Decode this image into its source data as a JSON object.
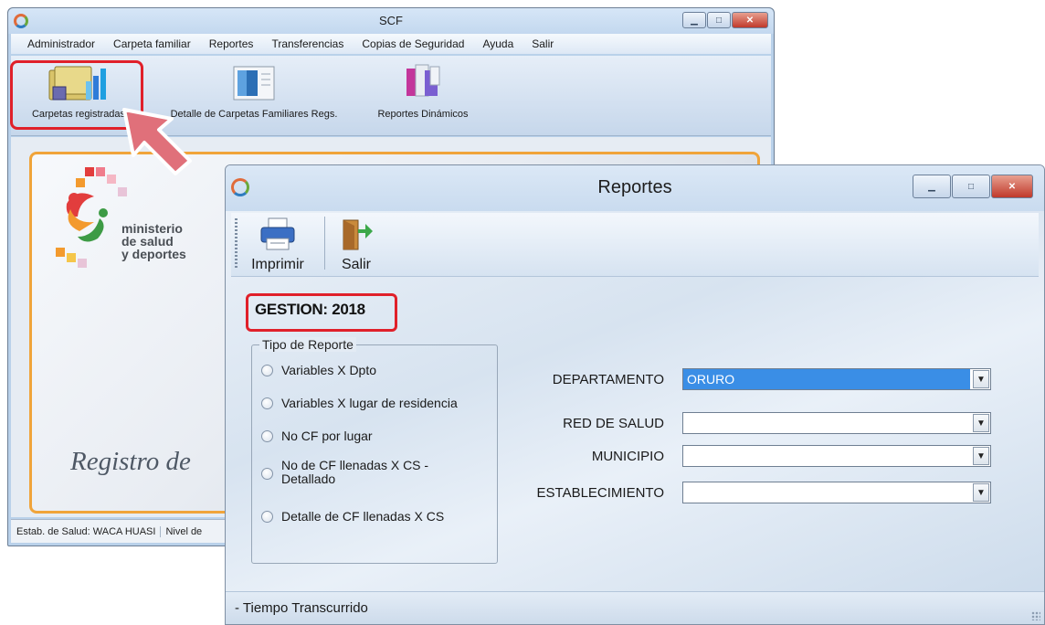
{
  "scf": {
    "title": "SCF",
    "menu": [
      "Administrador",
      "Carpeta familiar",
      "Reportes",
      "Transferencias",
      "Copias de Seguridad",
      "Ayuda",
      "Salir"
    ],
    "toolbar": {
      "carpetas_registradas": "Carpetas registradas",
      "detalle_carpetas": "Detalle de Carpetas Familiares Regs.",
      "reportes_dinamicos": "Reportes Dinámicos"
    },
    "branding": {
      "ministerio_line1": "ministerio",
      "ministerio_line2": "de salud",
      "ministerio_line3": "y deportes",
      "registro_text": "Registro de"
    },
    "statusbar": {
      "estab": "Estab. de Salud: WACA HUASI",
      "nivel": "Nivel de"
    }
  },
  "reportes": {
    "title": "Reportes",
    "toolbar": {
      "imprimir": "Imprimir",
      "salir": "Salir"
    },
    "gestion": "GESTION: 2018",
    "tipo_reporte": {
      "legend": "Tipo de Reporte",
      "options": [
        "Variables X Dpto",
        "Variables X lugar de residencia",
        "No CF por lugar",
        "No de CF llenadas X CS -",
        "Detallado",
        "Detalle de CF llenadas X CS"
      ]
    },
    "fields": {
      "departamento_label": "DEPARTAMENTO",
      "departamento_value": "ORURO",
      "red_label": "RED DE SALUD",
      "red_value": "",
      "municipio_label": "MUNICIPIO",
      "municipio_value": "",
      "establecimiento_label": "ESTABLECIMIENTO",
      "establecimiento_value": ""
    },
    "footer": "-  Tiempo Transcurrido"
  },
  "colors": {
    "highlight": "#e0202a",
    "selection": "#3a8ee6",
    "panel_border": "#f0a43a"
  }
}
